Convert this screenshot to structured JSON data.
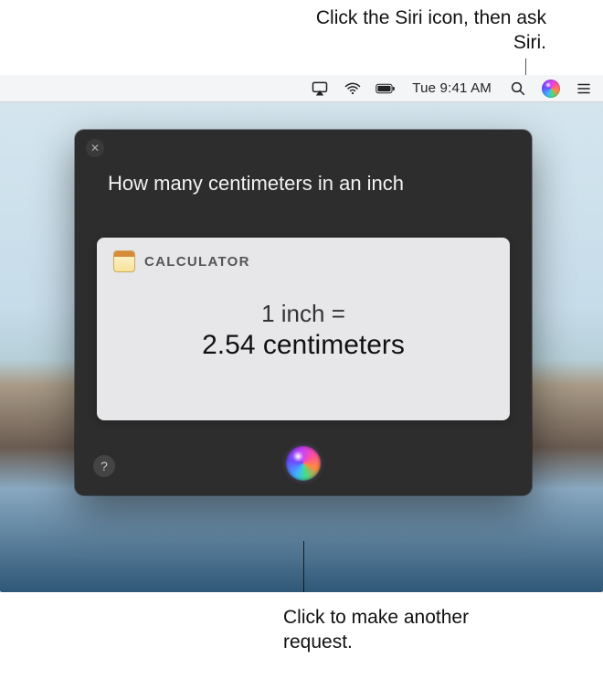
{
  "callouts": {
    "top": "Click the Siri icon, then ask Siri.",
    "bottom": "Click to make another request."
  },
  "menubar": {
    "clock": "Tue 9:41 AM",
    "icons": {
      "airplay": "airplay-icon",
      "wifi": "wifi-icon",
      "battery": "battery-icon",
      "spotlight": "spotlight-search-icon",
      "siri": "siri-icon",
      "notification_center": "notification-center-icon"
    }
  },
  "siri": {
    "query": "How many centimeters in an inch",
    "close_symbol": "✕",
    "help_symbol": "?",
    "result": {
      "source_label": "CALCULATOR",
      "line1": "1 inch =",
      "line2": "2.54 centimeters"
    }
  }
}
